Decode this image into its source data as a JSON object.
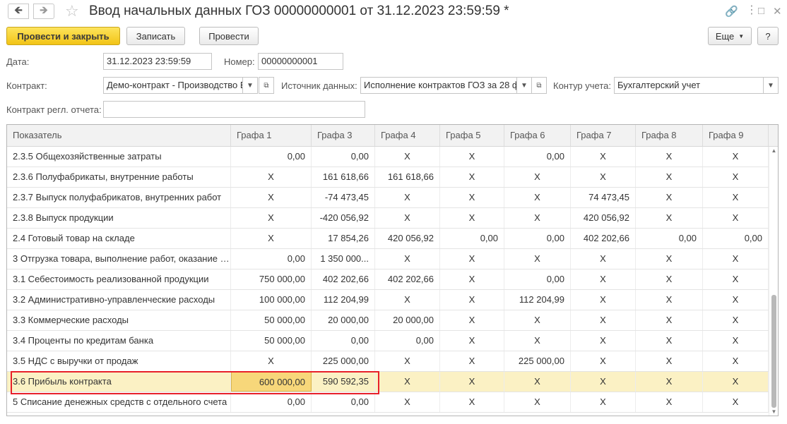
{
  "window": {
    "title": "Ввод начальных данных ГОЗ 00000000001 от 31.12.2023 23:59:59 *",
    "icons": [
      "arrow-left-icon",
      "arrow-right-icon",
      "star-icon",
      "link-icon",
      "more-icon",
      "maximize-icon",
      "close-icon"
    ]
  },
  "toolbar": {
    "post_and_close": "Провести и закрыть",
    "save": "Записать",
    "post": "Провести",
    "more": "Еще",
    "help": "?"
  },
  "form": {
    "date_label": "Дата:",
    "date_value": "31.12.2023 23:59:59",
    "number_label": "Номер:",
    "number_value": "00000000001",
    "contract_label": "Контракт:",
    "contract_value": "Демо-контракт - Производство Е",
    "source_label": "Источник данных:",
    "source_value": "Исполнение контрактов ГОЗ за 28 ф",
    "circuit_label": "Контур учета:",
    "circuit_value": "Бухгалтерский учет",
    "reg_contract_label": "Контракт регл. отчета:",
    "reg_contract_value": ""
  },
  "table": {
    "columns": [
      "Показатель",
      "Графа 1",
      "Графа 3",
      "Графа 4",
      "Графа 5",
      "Графа 6",
      "Графа 7",
      "Графа 8",
      "Графа 9"
    ],
    "rows": [
      [
        "2.3.5 Общехозяйственные затраты",
        "0,00",
        "0,00",
        "X",
        "X",
        "0,00",
        "X",
        "X",
        "X"
      ],
      [
        "2.3.6 Полуфабрикаты, внутренние работы",
        "X",
        "161 618,66",
        "161 618,66",
        "X",
        "X",
        "X",
        "X",
        "X"
      ],
      [
        "2.3.7 Выпуск полуфабрикатов, внутренних работ",
        "X",
        "-74 473,45",
        "X",
        "X",
        "X",
        "74 473,45",
        "X",
        "X"
      ],
      [
        "2.3.8 Выпуск продукции",
        "X",
        "-420 056,92",
        "X",
        "X",
        "X",
        "420 056,92",
        "X",
        "X"
      ],
      [
        "2.4 Готовый товар на складе",
        "X",
        "17 854,26",
        "420 056,92",
        "0,00",
        "0,00",
        "402 202,66",
        "0,00",
        "0,00"
      ],
      [
        "3 Отгрузка товара, выполнение работ, оказание услуг",
        "0,00",
        "1 350 000...",
        "X",
        "X",
        "X",
        "X",
        "X",
        "X"
      ],
      [
        "3.1 Себестоимость реализованной продукции",
        "750 000,00",
        "402 202,66",
        "402 202,66",
        "X",
        "0,00",
        "X",
        "X",
        "X"
      ],
      [
        "3.2 Административно-управленческие расходы",
        "100 000,00",
        "112 204,99",
        "X",
        "X",
        "112 204,99",
        "X",
        "X",
        "X"
      ],
      [
        "3.3 Коммерческие расходы",
        "50 000,00",
        "20 000,00",
        "20 000,00",
        "X",
        "X",
        "X",
        "X",
        "X"
      ],
      [
        "3.4 Проценты по кредитам банка",
        "50 000,00",
        "0,00",
        "0,00",
        "X",
        "X",
        "X",
        "X",
        "X"
      ],
      [
        "3.5 НДС с выручки от продаж",
        "X",
        "225 000,00",
        "X",
        "X",
        "225 000,00",
        "X",
        "X",
        "X"
      ],
      [
        "3.6 Прибыль контракта",
        "600 000,00",
        "590 592,35",
        "X",
        "X",
        "X",
        "X",
        "X",
        "X"
      ],
      [
        "5 Списание денежных средств с отдельного счета",
        "0,00",
        "0,00",
        "X",
        "X",
        "X",
        "X",
        "X",
        "X"
      ]
    ],
    "selected_row": 11
  }
}
